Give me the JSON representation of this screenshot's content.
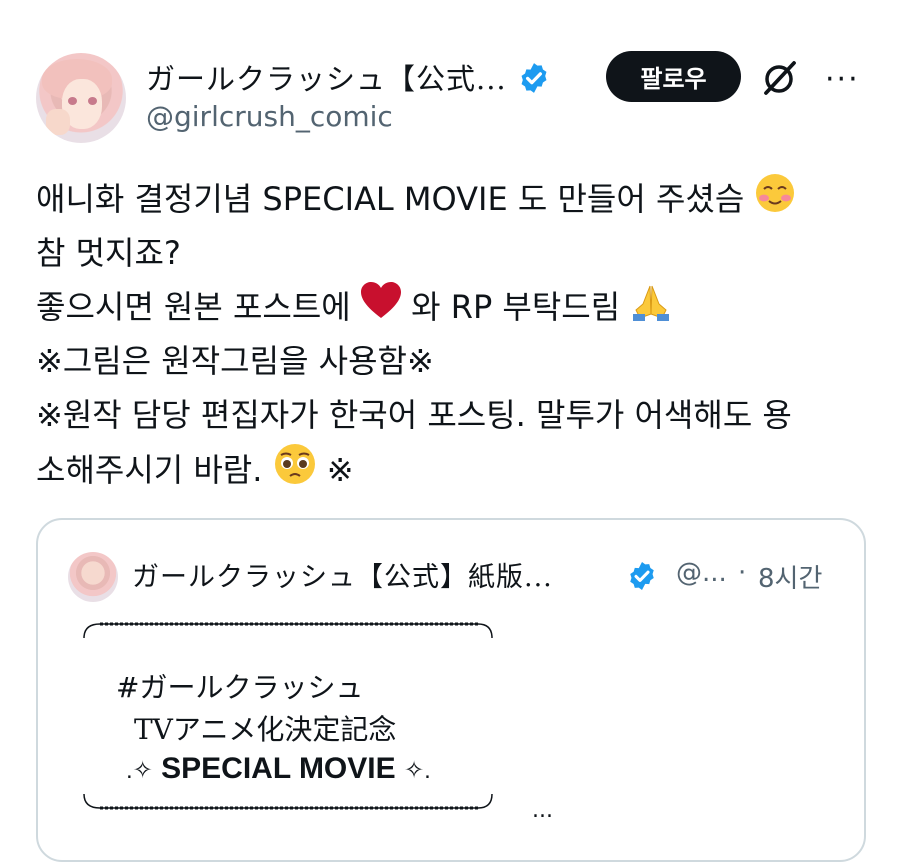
{
  "author": {
    "display_name": "ガールクラッシュ【公式...",
    "handle": "@girlcrush_comic",
    "verified": true
  },
  "actions": {
    "follow_label": "팔로우",
    "grok_icon": "grok-slash-icon",
    "more_icon": "more-dots-icon",
    "more_glyph": "···"
  },
  "post": {
    "lines": [
      "애니화 결정기념 SPECIAL MOVIE 도 만들어 주셨슴",
      "참 멋지죠?",
      "좋으시면 원본 포스트에 ",
      "와 RP 부탁드림",
      "※그림은 원작그림을 사용함※",
      "※원작 담당 편집자가 한국어 포스팅. 말투가 어색해도 용",
      "소해주시기 바람.",
      "※"
    ],
    "emojis": [
      "smiling-blush-emoji",
      "red-heart-emoji",
      "folded-hands-emoji",
      "pleading-face-emoji"
    ]
  },
  "quote": {
    "display_name": "ガールクラッシュ【公式】紙版...",
    "handle": "@...",
    "separator": "·",
    "time": "8시간",
    "frame_lines": [
      "#ガールクラッシュ",
      "TVアニメ化決定記念",
      "SPECIAL MOVIE"
    ],
    "sparkle_left": ".✧",
    "sparkle_right": "✧.",
    "more": "..."
  },
  "colors": {
    "text": "#0f1419",
    "secondary": "#536471",
    "verified_blue": "#1d9bf0",
    "heart_red": "#c8102e",
    "border": "#cfd9de"
  }
}
